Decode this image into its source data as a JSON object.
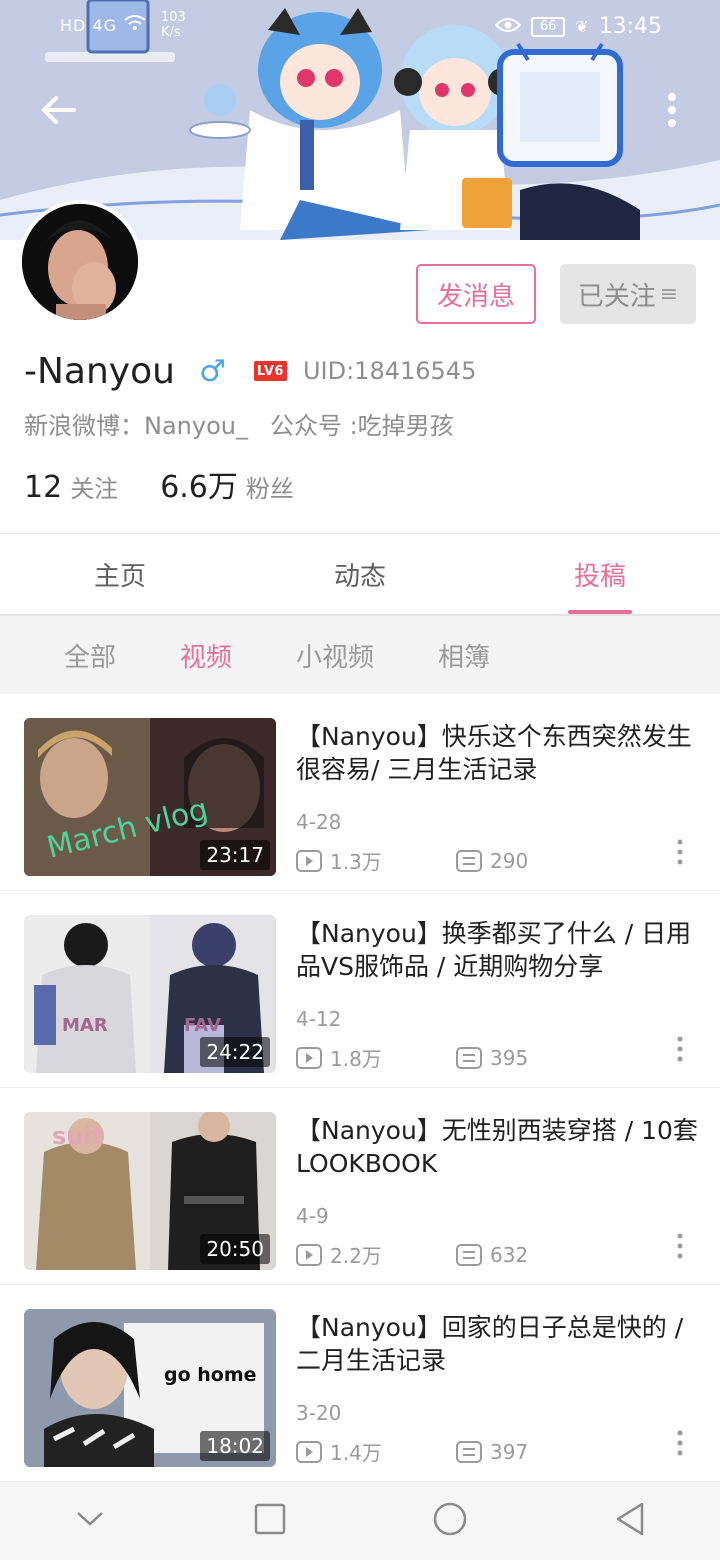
{
  "status_bar": {
    "signal": "HD 4G",
    "net_speed_value": "103",
    "net_speed_unit": "K/s",
    "battery": "66",
    "time": "13:45"
  },
  "header": {
    "back_icon": "arrow-left-icon",
    "more_icon": "vertical-dots-icon"
  },
  "profile": {
    "name": "-Nanyou",
    "gender_symbol": "♂",
    "level": "LV6",
    "uid": "UID:18416545",
    "weibo": "新浪微博：Nanyou_",
    "wechat": "公众号 :吃掉男孩",
    "following_count": "12",
    "following_label": "关注",
    "followers_count": "6.6万",
    "followers_label": "粉丝",
    "message_button": "发消息",
    "followed_button": "已关注",
    "followed_icon": "≡"
  },
  "tabs": [
    {
      "label": "主页",
      "active": false
    },
    {
      "label": "动态",
      "active": false
    },
    {
      "label": "投稿",
      "active": true
    }
  ],
  "subtabs": [
    {
      "label": "全部",
      "active": false
    },
    {
      "label": "视频",
      "active": true
    },
    {
      "label": "小视频",
      "active": false
    },
    {
      "label": "相簿",
      "active": false
    }
  ],
  "videos": [
    {
      "title": "【Nanyou】快乐这个东西突然发生很容易/ 三月生活记录",
      "duration": "23:17",
      "date": "4-28",
      "views": "1.3万",
      "comments": "290",
      "thumb_text": "March vlog"
    },
    {
      "title": "【Nanyou】换季都买了什么 / 日用品VS服饰品 / 近期购物分享",
      "duration": "24:22",
      "date": "4-12",
      "views": "1.8万",
      "comments": "395",
      "thumb_text_left": "MAR",
      "thumb_text_right": "FAV"
    },
    {
      "title": "【Nanyou】无性别西装穿搭 / 10套LOOKBOOK",
      "duration": "20:50",
      "date": "4-9",
      "views": "2.2万",
      "comments": "632",
      "thumb_text": "suit"
    },
    {
      "title": "【Nanyou】回家的日子总是快的 / 二月生活记录",
      "duration": "18:02",
      "date": "3-20",
      "views": "1.4万",
      "comments": "397",
      "thumb_text": "go home"
    }
  ],
  "colors": {
    "accent": "#e86f97",
    "gender_blue": "#4ba8e8",
    "level_red": "#e8332e",
    "secondary_text": "#8e8e8e"
  }
}
